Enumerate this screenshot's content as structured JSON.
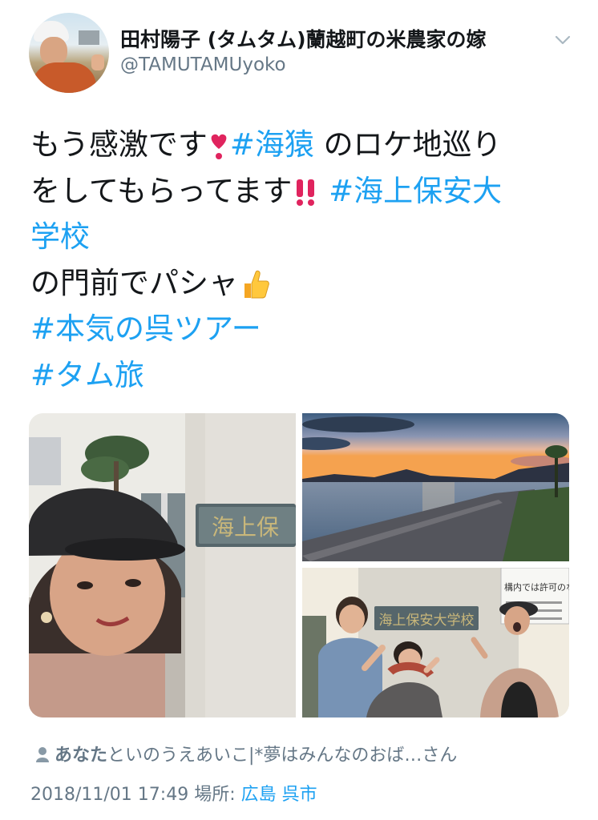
{
  "author": {
    "display_name": "田村陽子 (タムタム)蘭越町の米農家の嫁",
    "handle": "@TAMUTAMUyoko"
  },
  "tweet": {
    "line1": {
      "t1": "もう感激です",
      "tag1": "#海猿",
      "t2": " のロケ地巡り"
    },
    "line2": {
      "t1": "をしてもらってます",
      "tag1": "#海上保安大"
    },
    "line3": {
      "tag1": "学校"
    },
    "line4": {
      "t1": "の門前でパシャ"
    },
    "line5": {
      "tag1": "#本気の呉ツアー"
    },
    "line6": {
      "tag1": "#タム旅"
    }
  },
  "media": {
    "sign_left": "海上保",
    "sign_right": "海上保安大学校",
    "notice_right": "構内では許可のない方"
  },
  "likes": {
    "icon": "person-icon",
    "you": "あなた",
    "others": "といのうえあいこ|*夢はみんなのおば…さん"
  },
  "meta": {
    "timestamp": "2018/11/01 17:49",
    "location_label": "場所:",
    "location_value": "広島 呉市"
  },
  "colors": {
    "hashtag": "#1da1f2",
    "secondary_text": "#657786",
    "primary_text": "#14171a"
  }
}
